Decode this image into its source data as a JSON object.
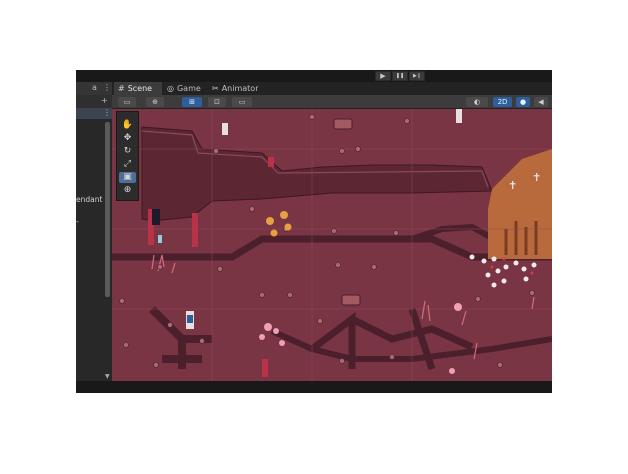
{
  "playbar": {
    "play_icon": "▶",
    "pause_icon": "❚❚",
    "step_icon": "▶❙"
  },
  "hierarchy": {
    "lock_icon": "a",
    "menu_icon": "⋮",
    "add_icon": "+",
    "partial_text": "endant",
    "dash_text": "-",
    "menu2_icon": "⋮"
  },
  "tabs": [
    {
      "label": "Scene",
      "icon": "#",
      "active": true
    },
    {
      "label": "Game",
      "icon": "◎",
      "active": false
    },
    {
      "label": "Animator",
      "icon": "✂",
      "active": false
    }
  ],
  "toolbar": {
    "mode_2d_label": "2D",
    "light_icon": "💡",
    "audio_icon": "◀)",
    "shading_icon": "◐",
    "global_icon": "⊕",
    "grid_icon": "⊞",
    "snap_icon": "⊡",
    "rect_icon": "▭",
    "dropdown_icon": "▾"
  },
  "tools": [
    {
      "name": "view-tool",
      "icon": "✋"
    },
    {
      "name": "move-tool",
      "icon": "✥"
    },
    {
      "name": "rotate-tool",
      "icon": "↻"
    },
    {
      "name": "scale-tool",
      "icon": "⤢"
    },
    {
      "name": "rect-tool",
      "icon": "▣"
    },
    {
      "name": "transform-tool",
      "icon": "⊕"
    }
  ],
  "scene_colors": {
    "ground": "#7a3545",
    "path": "#4a1f2a",
    "wall": "#5a2a34",
    "church": "#b86a3c",
    "accent_blue": "#2f5f9a"
  }
}
